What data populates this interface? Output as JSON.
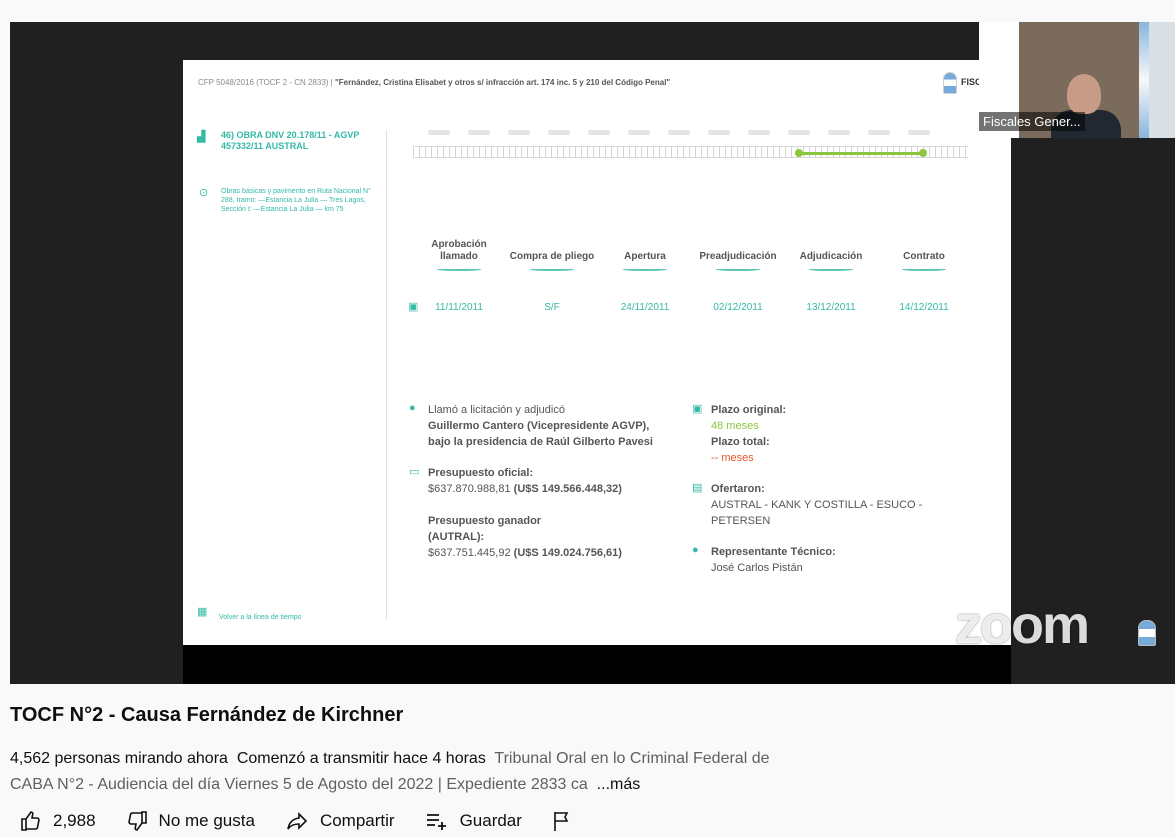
{
  "slide": {
    "header_prefix": "CFP 5048/2016 (TOCF 2 - CN 2833) |",
    "header_case": "\"Fernández, Cristina Elisabet y otros s/ infracción art. 174 inc. 5 y 210 del Código Penal\"",
    "fisc_label": "FISC",
    "obra_title": "46) OBRA DNV 20.178/11 - AGVP 457332/11 AUSTRAL",
    "obra_desc": "Obras básicas y pavimento en Ruta Nacional N° 288, tramo: —Estancia La Julia — Tres Lagos, Sección I: —Estancia La Julia — km 75",
    "back_link": "Volver a la línea de tiempo",
    "stages": [
      {
        "label": "Aprobación llamado",
        "date": "11/11/2011"
      },
      {
        "label": "Compra de pliego",
        "date": "S/F"
      },
      {
        "label": "Apertura",
        "date": "24/11/2011"
      },
      {
        "label": "Preadjudicación",
        "date": "02/12/2011"
      },
      {
        "label": "Adjudicación",
        "date": "13/12/2011"
      },
      {
        "label": "Contrato",
        "date": "14/12/2011"
      }
    ],
    "llamo_label": "Llamó a licitación y adjudicó",
    "llamo_person": "Guillermo Cantero (Vicepresidente AGVP),",
    "llamo_presidency": "bajo la presidencia de Raúl Gilberto Pavesi",
    "presupuesto_oficial_label": "Presupuesto oficial:",
    "presupuesto_oficial_ars": "$637.870.988,81",
    "presupuesto_oficial_usd": "(U$S 149.566.448,32)",
    "presupuesto_ganador_label": "Presupuesto ganador",
    "presupuesto_ganador_sub": "(AUTRAL):",
    "presupuesto_ganador_ars": "$637.751.445,92",
    "presupuesto_ganador_usd": "(U$S 149.024.756,61)",
    "plazo_original_label": "Plazo original:",
    "plazo_original_value": "48 meses",
    "plazo_total_label": "Plazo total:",
    "plazo_total_value": "-- meses",
    "ofertaron_label": "Ofertaron:",
    "ofertaron_line1": "AUSTRAL - KANK Y COSTILLA - ESUCO -",
    "ofertaron_line2": "PETERSEN",
    "representante_label": "Representante Técnico:",
    "representante_value": "José Carlos Pistán"
  },
  "camera": {
    "label": "Fiscales Gener..."
  },
  "zoom_watermark": "zoom",
  "video": {
    "title": "TOCF N°2 - Causa Fernández de Kirchner",
    "viewers": "4,562 personas mirando ahora",
    "started": "Comenzó a transmitir hace 4 horas",
    "description": "Tribunal Oral en lo Criminal Federal de CABA N°2 - Audiencia del día Viernes 5 de Agosto del 2022 | Expediente 2833 ca",
    "more": "...más"
  },
  "actions": {
    "likes": "2,988",
    "dislike": "No me gusta",
    "share": "Compartir",
    "save": "Guardar"
  },
  "icons": [
    "like-icon",
    "dislike-icon",
    "share-icon",
    "save-playlist-icon",
    "flag-icon",
    "calendar-icon",
    "person-icon",
    "money-icon",
    "document-icon",
    "location-icon"
  ],
  "colors": {
    "teal": "#33b9a6",
    "green": "#8cc63f",
    "red": "#e4572e"
  }
}
